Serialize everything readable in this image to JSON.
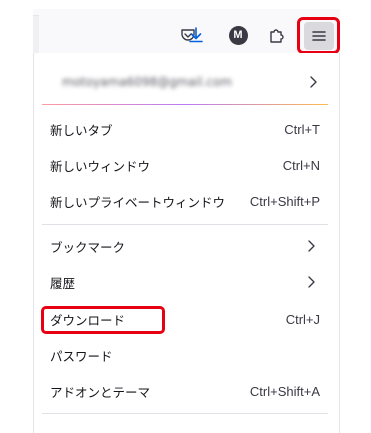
{
  "toolbar": {
    "icons": [
      "pocket-icon",
      "download-icon",
      "account-icon",
      "extensions-icon",
      "hamburger-menu-icon"
    ],
    "account_initial": "M",
    "accent": "#0060df",
    "highlight_color": "#e60012"
  },
  "account": {
    "email": "motoyama6098@gmail.com"
  },
  "menu": {
    "items": [
      {
        "label": "新しいタブ",
        "shortcut": "Ctrl+T"
      },
      {
        "label": "新しいウィンドウ",
        "shortcut": "Ctrl+N"
      },
      {
        "label": "新しいプライベートウィンドウ",
        "shortcut": "Ctrl+Shift+P"
      },
      {
        "label": "ブックマーク",
        "shortcut": ""
      },
      {
        "label": "履歴",
        "shortcut": ""
      },
      {
        "label": "ダウンロード",
        "shortcut": "Ctrl+J"
      },
      {
        "label": "パスワード",
        "shortcut": ""
      },
      {
        "label": "アドオンとテーマ",
        "shortcut": "Ctrl+Shift+A"
      }
    ]
  }
}
